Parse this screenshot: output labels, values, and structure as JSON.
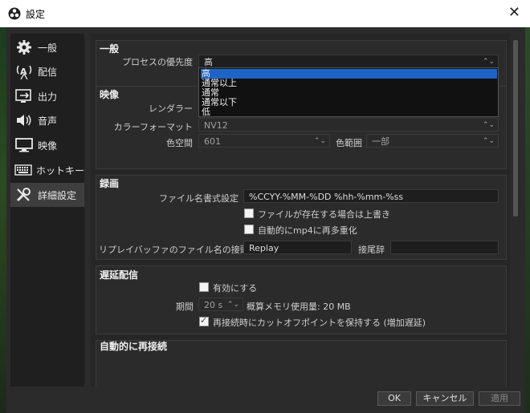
{
  "window": {
    "title": "設定"
  },
  "sidebar": {
    "items": [
      {
        "label": "一般",
        "icon": "gear-icon"
      },
      {
        "label": "配信",
        "icon": "broadcast-icon"
      },
      {
        "label": "出力",
        "icon": "output-icon"
      },
      {
        "label": "音声",
        "icon": "speaker-icon"
      },
      {
        "label": "映像",
        "icon": "monitor-icon"
      },
      {
        "label": "ホットキー",
        "icon": "keyboard-icon"
      },
      {
        "label": "詳細設定",
        "icon": "wrench-icon"
      }
    ],
    "selected": 6
  },
  "general": {
    "title": "一般",
    "priority_label": "プロセスの優先度",
    "priority_value": "高"
  },
  "priority_dropdown": {
    "options": [
      "高",
      "通常以上",
      "通常",
      "通常以下",
      "低"
    ],
    "highlighted": 0
  },
  "video": {
    "title": "映像",
    "renderer_label": "レンダラー",
    "color_format_label": "カラーフォーマット",
    "color_format_value": "NV12",
    "color_space_label": "色空間",
    "color_space_value": "601",
    "color_range_label": "色範囲",
    "color_range_value": "一部"
  },
  "recording": {
    "title": "録画",
    "filename_format_label": "ファイル名書式設定",
    "filename_format_value": "%CCYY-%MM-%DD %hh-%mm-%ss",
    "overwrite_label": "ファイルが存在する場合は上書き",
    "overwrite_checked": false,
    "auto_remux_label": "自動的にmp4に再多重化",
    "auto_remux_checked": false,
    "replay_prefix_label": "リプレイバッファのファイル名の接頭辞",
    "replay_prefix_value": "Replay",
    "suffix_label": "接尾辞",
    "suffix_value": ""
  },
  "stream_delay": {
    "title": "遅延配信",
    "enable_label": "有効にする",
    "enable_checked": false,
    "duration_label": "期間",
    "duration_value": "20 s",
    "memory_label": "概算メモリ使用量: 20 MB",
    "preserve_label": "再接続時にカットオフポイントを保持する (増加遅延)",
    "preserve_checked": true
  },
  "auto_reconnect": {
    "title": "自動的に再接続"
  },
  "buttons": {
    "ok": "OK",
    "cancel": "キャンセル",
    "apply": "適用"
  },
  "colors": {
    "highlight": "#1e63c7",
    "background": "#2b2b2b"
  }
}
